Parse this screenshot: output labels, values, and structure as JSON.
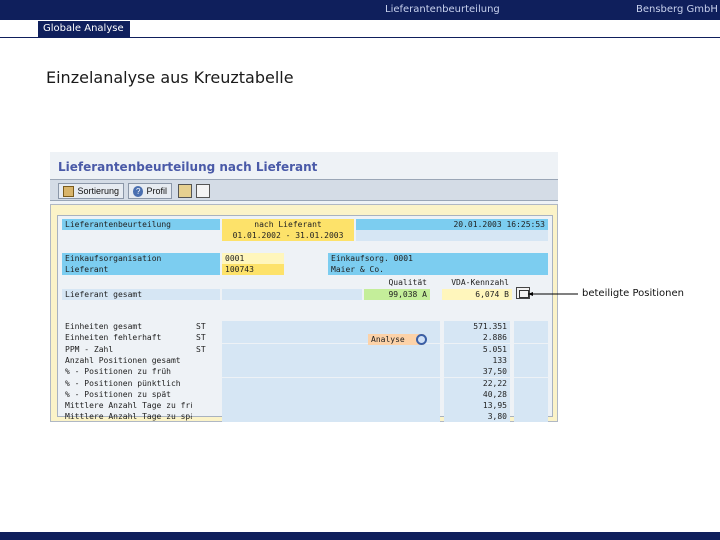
{
  "header": {
    "center_title": "Lieferantenbeurteilung",
    "right_title": "Bensberg GmbH",
    "section_tag": "Globale Analyse"
  },
  "page_title": "Einzelanalyse aus Kreuztabelle",
  "screenshot": {
    "title": "Lieferantenbeurteilung nach Lieferant",
    "toolbar": {
      "sort_label": "Sortierung",
      "profile_label": "Profil"
    },
    "header_block": {
      "label": "Lieferantenbeurteilung",
      "mode": "nach Lieferant",
      "period": "01.01.2002 - 31.01.2003",
      "timestamp": "20.01.2003 16:25:53"
    },
    "org_block": {
      "org_label": "Einkaufsorganisation",
      "org_value": "0001",
      "org_name_label": "Einkaufsorg. 0001",
      "supplier_label": "Lieferant",
      "supplier_value": "100743",
      "supplier_name": "Maier & Co."
    },
    "score_block": {
      "quality_header": "Qualität",
      "vda_header": "VDA-Kennzahl",
      "total_label": "Lieferant gesamt",
      "quality_value": "99,038 A",
      "vda_value": "6,074 B"
    },
    "kpis": [
      {
        "label": "Einheiten gesamt",
        "unit": "ST",
        "value": "571.351"
      },
      {
        "label": "Einheiten fehlerhaft",
        "unit": "ST",
        "value": "2.886"
      },
      {
        "label": "PPM - Zahl",
        "unit": "ST",
        "value": "5.051"
      },
      {
        "label": "Anzahl Positionen gesamt",
        "unit": "",
        "value": "133"
      },
      {
        "label": "% - Positionen zu früh",
        "unit": "",
        "value": "37,50"
      },
      {
        "label": "% - Positionen pünktlich",
        "unit": "",
        "value": "22,22"
      },
      {
        "label": "% - Positionen zu spät",
        "unit": "",
        "value": "40,28"
      },
      {
        "label": "Mittlere Anzahl Tage zu früh",
        "unit": "",
        "value": "13,95"
      },
      {
        "label": "Mittlere Anzahl Tage zu spät",
        "unit": "",
        "value": "3,80"
      }
    ],
    "analyse_label": "Analyse"
  },
  "callout": "beteiligte Positionen"
}
